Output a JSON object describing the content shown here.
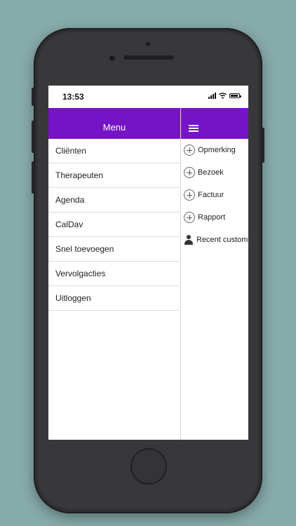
{
  "colors": {
    "background": "#87abaa",
    "header": "#7514c6"
  },
  "status_bar": {
    "time": "13:53",
    "icons": [
      "signal-icon",
      "wifi-icon",
      "battery-icon"
    ]
  },
  "header": {
    "title": "Menu",
    "menu_icon": "hamburger-icon"
  },
  "menu": {
    "items": [
      {
        "label": "Cliënten"
      },
      {
        "label": "Therapeuten"
      },
      {
        "label": "Agenda"
      },
      {
        "label": "CalDav"
      },
      {
        "label": "Snel toevoegen"
      },
      {
        "label": "Vervolgacties"
      },
      {
        "label": "Uitloggen"
      }
    ]
  },
  "actions": {
    "items": [
      {
        "label": "Opmerking",
        "icon": "plus-circle-icon"
      },
      {
        "label": "Bezoek",
        "icon": "plus-circle-icon"
      },
      {
        "label": "Factuur",
        "icon": "plus-circle-icon"
      },
      {
        "label": "Rapport",
        "icon": "plus-circle-icon"
      },
      {
        "label": "Recent custom",
        "icon": "person-icon"
      }
    ]
  }
}
